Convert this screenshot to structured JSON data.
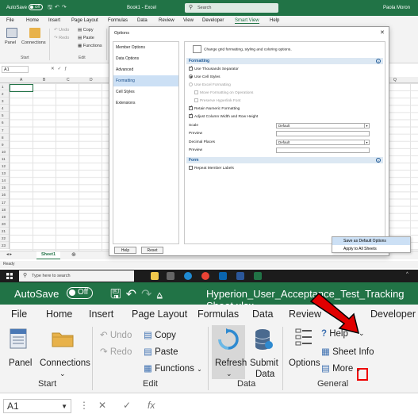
{
  "top_window": {
    "titlebar": {
      "autosave": "AutoSave",
      "toggle": "Off",
      "title": "Book1 - Excel",
      "search_placeholder": "Search",
      "user": "Paola Moron"
    },
    "tabs": [
      "File",
      "Home",
      "Insert",
      "Page Layout",
      "Formulas",
      "Data",
      "Review",
      "View",
      "Developer",
      "Smart View",
      "Help"
    ],
    "active_tab": "Smart View",
    "ribbon": {
      "panel": "Panel",
      "connections": "Connections",
      "undo": "Undo",
      "redo": "Redo",
      "copy": "Copy",
      "paste": "Paste",
      "functions": "Functions",
      "group_start": "Start",
      "group_edit": "Edit"
    },
    "name_box": "A1",
    "columns": [
      "A",
      "B",
      "C",
      "D",
      "Q"
    ],
    "rows": [
      "1",
      "2",
      "3",
      "4",
      "5",
      "6",
      "7",
      "8",
      "9",
      "10",
      "11",
      "12",
      "13",
      "14",
      "15",
      "16",
      "17",
      "18",
      "19",
      "20",
      "21",
      "22",
      "23"
    ],
    "sheet_tab": "Sheet1",
    "status": "Ready"
  },
  "options_dialog": {
    "title": "Options",
    "nav": [
      "Member Options",
      "Data Options",
      "Advanced",
      "Formatting",
      "Cell Styles",
      "Extensions"
    ],
    "selected_nav": "Formatting",
    "intro": "Change grid formatting, styling and coloring options.",
    "section_formatting": "Formatting",
    "section_form": "Form",
    "options": {
      "thousands": "Use Thousands Separator",
      "cell_styles": "Use Cell Styles",
      "excel_formatting": "Use Excel Formatting",
      "move_formatting": "Move Formatting on Operations",
      "preserve_hyperlink": "Preserve Hyperlink Font",
      "retain_numeric": "Retain Numeric Formatting",
      "adjust_width": "Adjust Column Width and Row Height",
      "repeat_labels": "Repeat Member Labels"
    },
    "fields": {
      "scale_label": "Scale",
      "scale_value": "Default",
      "preview_label": "Preview",
      "decimal_label": "Decimal Places",
      "decimal_value": "Default",
      "preview2_label": "Preview"
    },
    "buttons": {
      "help": "Help",
      "reset": "Reset"
    },
    "context_menu": [
      "Save as Default Options",
      "Apply to All Sheets"
    ]
  },
  "taskbar": {
    "search": "Type here to search"
  },
  "zoom_window": {
    "autosave": "AutoSave",
    "toggle": "Off",
    "file_title": "Hyperion_User_Acceptance_Test_Tracking Sheet.xlsx",
    "tabs": [
      "File",
      "Home",
      "Insert",
      "Page Layout",
      "Formulas",
      "Data",
      "Review",
      "Developer"
    ],
    "ribbon": {
      "panel": "Panel",
      "connections": "Connections",
      "undo": "Undo",
      "redo": "Redo",
      "copy": "Copy",
      "paste": "Paste",
      "functions": "Functions",
      "refresh": "Refresh",
      "submit": "Submit",
      "submit2": "Data",
      "options": "Options",
      "help": "Help",
      "sheet_info": "Sheet Info",
      "more": "More",
      "group_start": "Start",
      "group_edit": "Edit",
      "group_data": "Data",
      "group_general": "General"
    },
    "name_box": "A1",
    "fx": "fx"
  },
  "colors": {
    "excel_green": "#217346",
    "highlight": "#e00000"
  }
}
